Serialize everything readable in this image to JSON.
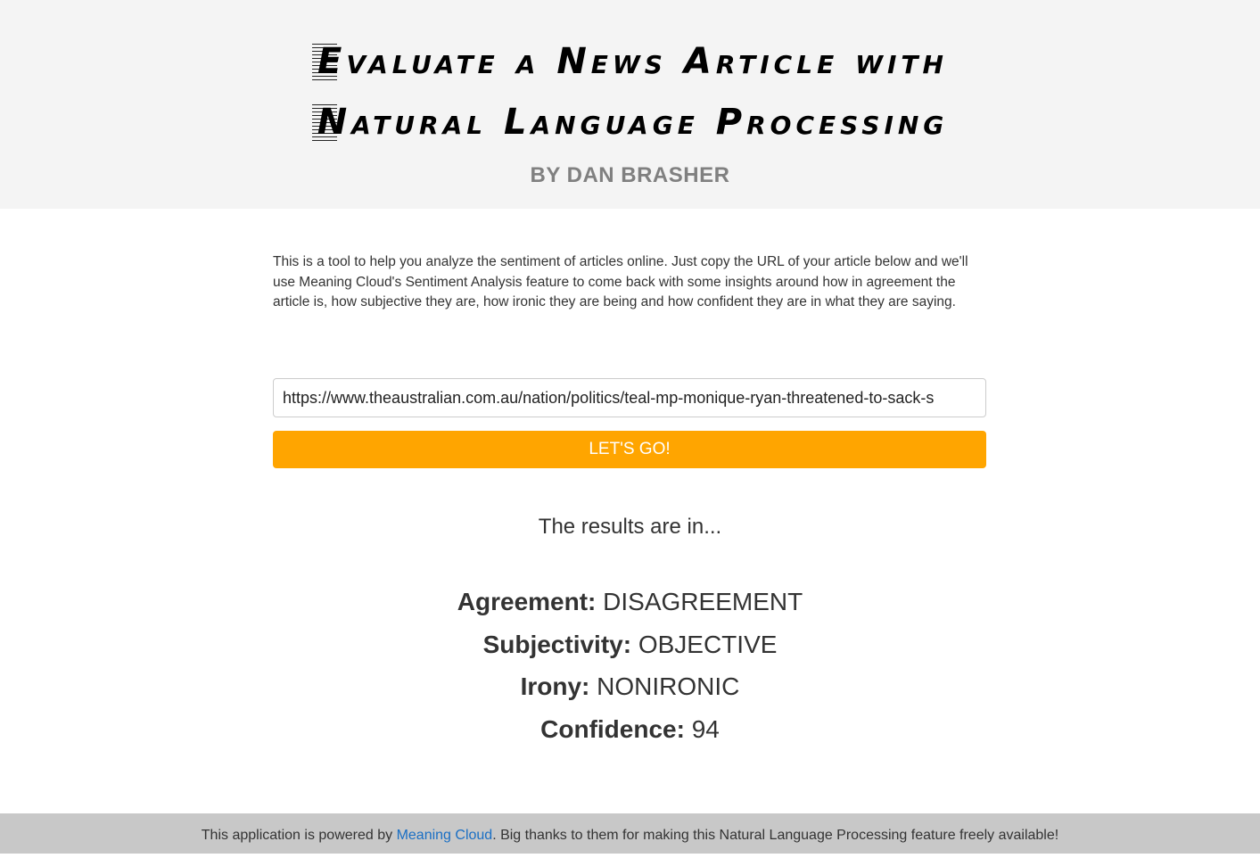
{
  "header": {
    "title_line_1": "Evaluate a News Article with",
    "title_line_2": "Natural Language Processing",
    "byline": "BY DAN BRASHER"
  },
  "intro": {
    "text": "This is a tool to help you analyze the sentiment of articles online. Just copy the URL of your article below and we'll use Meaning Cloud's Sentiment Analysis feature to come back with some insights around how in agreement the article is, how subjective they are, how ironic they are being and how confident they are in what they are saying."
  },
  "form": {
    "url_value": "https://www.theaustralian.com.au/nation/politics/teal-mp-monique-ryan-threatened-to-sack-s",
    "submit_label": "LET'S GO!"
  },
  "results": {
    "heading": "The results are in...",
    "agreement_label": "Agreement:",
    "agreement_value": "DISAGREEMENT",
    "subjectivity_label": "Subjectivity:",
    "subjectivity_value": "OBJECTIVE",
    "irony_label": "Irony:",
    "irony_value": "NONIRONIC",
    "confidence_label": "Confidence:",
    "confidence_value": "94"
  },
  "footer": {
    "text_before": "This application is powered by ",
    "link_text": "Meaning Cloud",
    "text_after": ". Big thanks to them for making this Natural Language Processing feature freely available!"
  },
  "colors": {
    "header_bg": "#f4f4f4",
    "button_bg": "#ffa500",
    "footer_bg": "#c8c8c8",
    "link": "#1a6fc4",
    "byline": "#808080"
  }
}
